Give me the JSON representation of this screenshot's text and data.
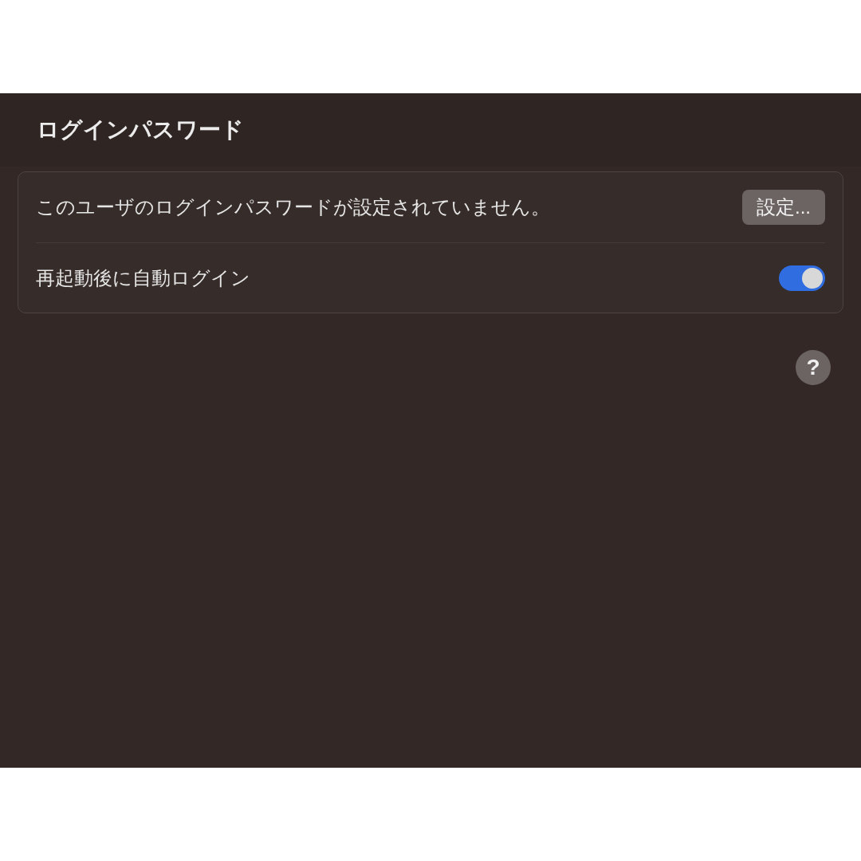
{
  "header": {
    "title": "ログインパスワード"
  },
  "rows": [
    {
      "kind": "button",
      "label": "このユーザのログインパスワードが設定されていません。",
      "button": "設定..."
    },
    {
      "kind": "toggle",
      "label": "再起動後に自動ログイン",
      "on": true
    }
  ],
  "help": {
    "label": "?"
  }
}
